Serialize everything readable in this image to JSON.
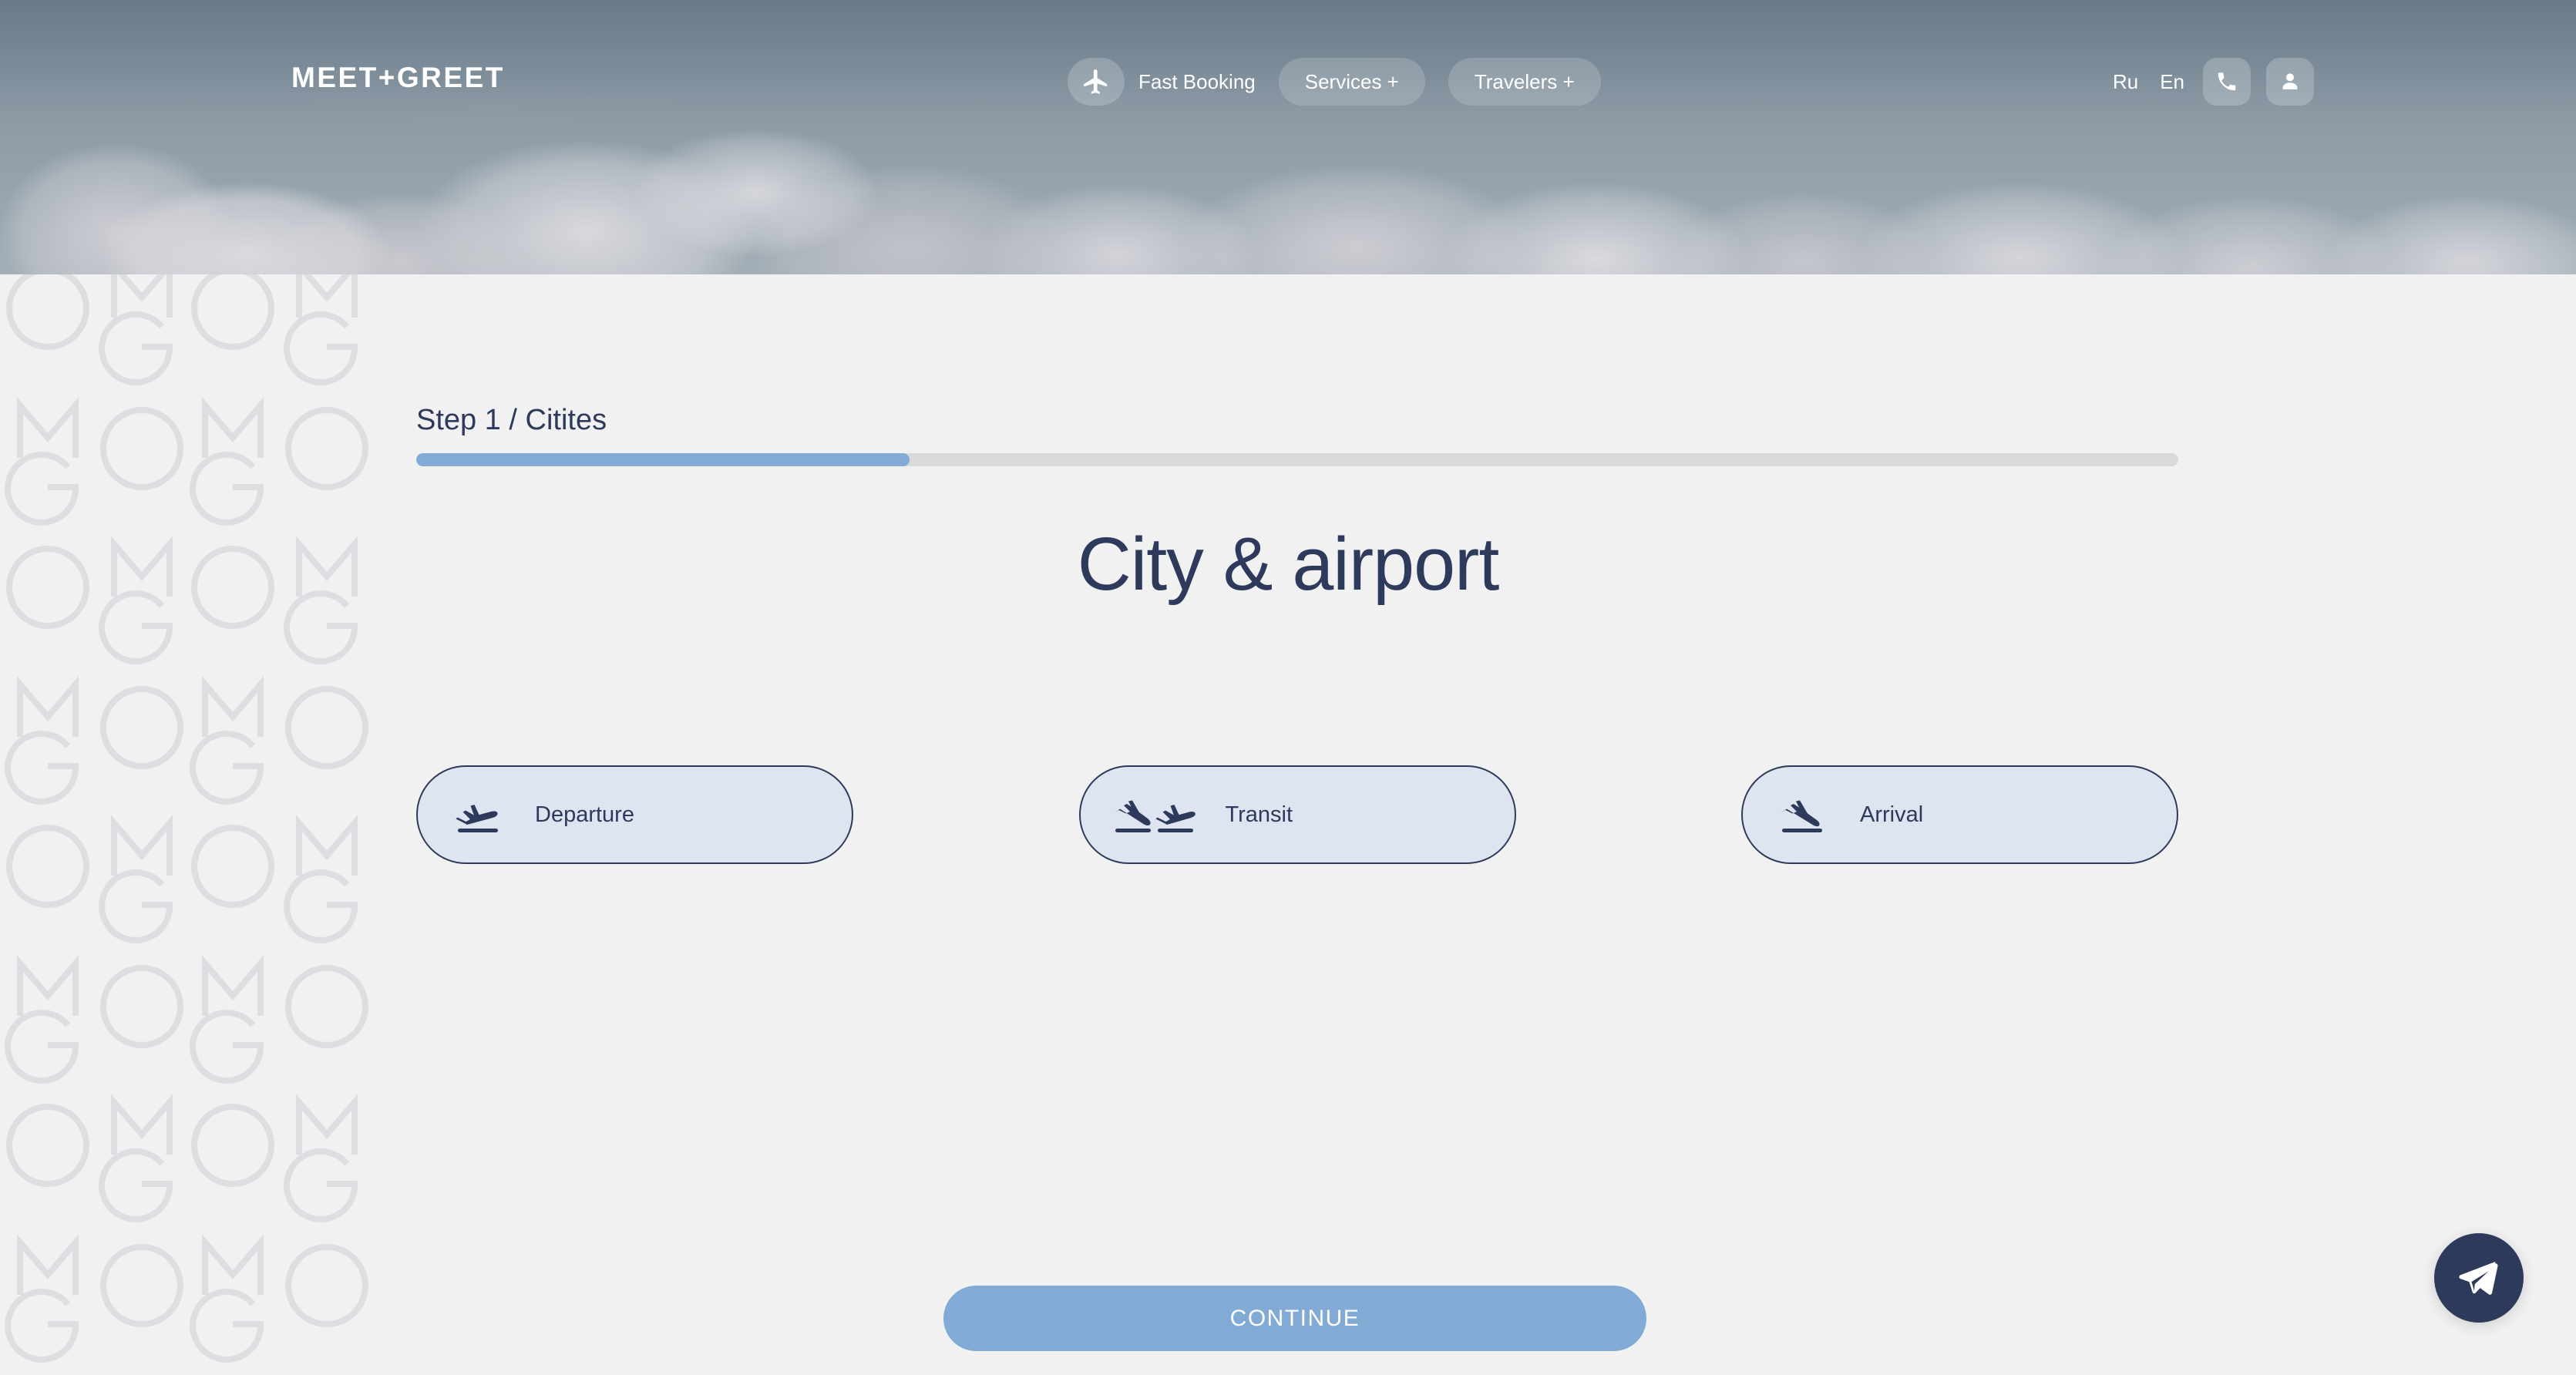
{
  "header": {
    "logo": "MEET+GREET",
    "nav": [
      {
        "label": "Fast Booking",
        "icon": "airplane-icon",
        "type": "pill-with-icon"
      },
      {
        "label": "Services +",
        "icon": "",
        "type": "pill"
      },
      {
        "label": "Travelers +",
        "icon": "",
        "type": "pill"
      }
    ],
    "languages": [
      {
        "code": "Ru",
        "active": false
      },
      {
        "code": "En",
        "active": true
      }
    ],
    "actions": [
      {
        "name": "phone-icon",
        "label": "Phone"
      },
      {
        "name": "user-icon",
        "label": "Account"
      }
    ]
  },
  "progress": {
    "step_label": "Step 1 / Citites",
    "percent": 28
  },
  "main": {
    "title": "City & airport",
    "options": [
      {
        "label": "Departure",
        "icon": "plane-takeoff-icon"
      },
      {
        "label": "Transit",
        "icon": "plane-transit-icon"
      },
      {
        "label": "Arrival",
        "icon": "plane-landing-icon"
      }
    ],
    "continue_label": "CONTINUE"
  },
  "floating": {
    "name": "telegram-icon",
    "label": "Telegram"
  },
  "watermark": {
    "letters": [
      "O",
      "M",
      "G"
    ]
  },
  "colors": {
    "accent_blue": "#81abd4",
    "navy": "#2e3a5c",
    "card_fill": "#dee4f0",
    "page_bg": "#f1f1f1",
    "track_gray": "#d9d9d9"
  }
}
